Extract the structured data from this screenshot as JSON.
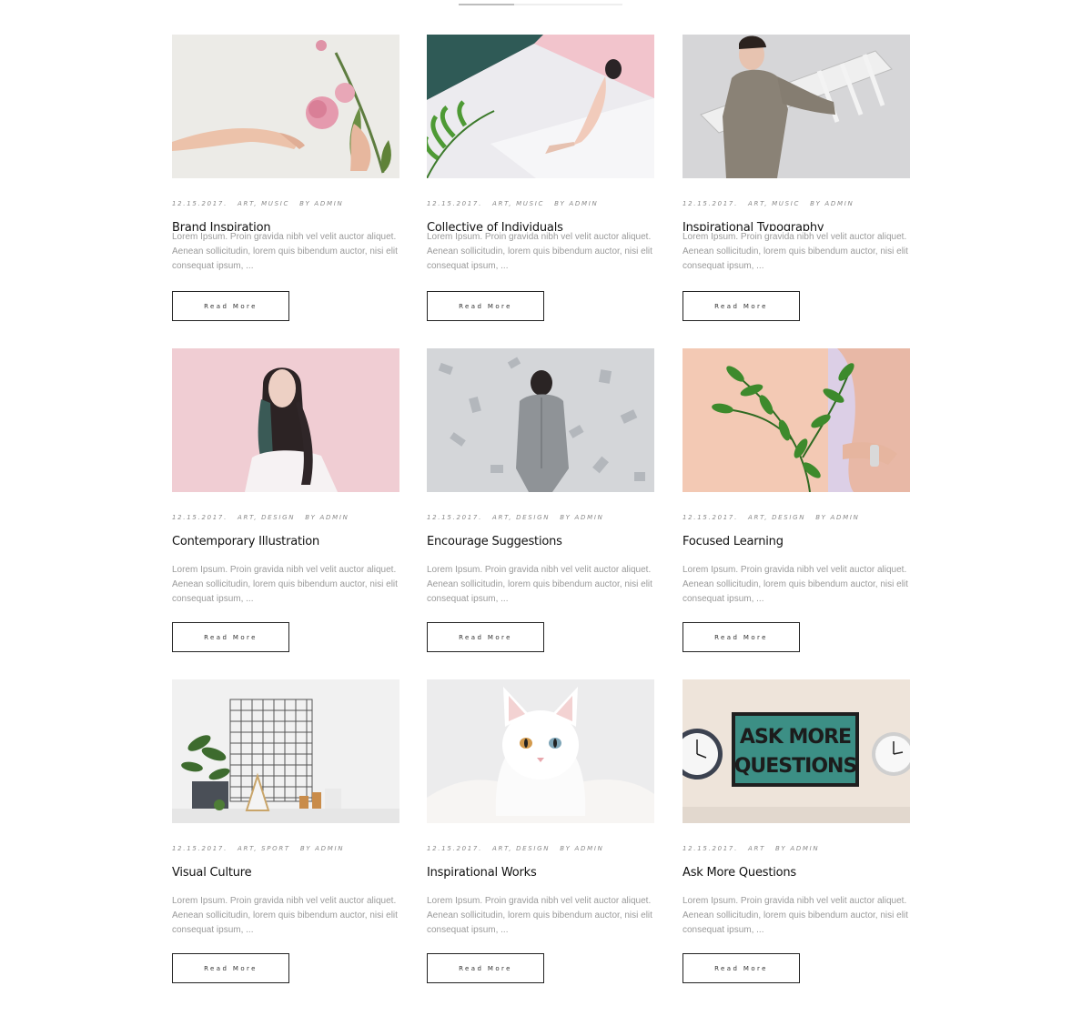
{
  "posts": [
    {
      "date": "12.15.2017.",
      "categories": "ART, MUSIC",
      "author": "BY ADMIN",
      "title": "Brand Inspiration",
      "excerpt": "Lorem Ipsum. Proin gravida nibh vel velit auctor aliquet. Aenean sollicitudin, lorem quis bibendum auctor, nisi elit consequat ipsum, ...",
      "button": "Read More",
      "image": "hand-pink-rose"
    },
    {
      "date": "12.15.2017.",
      "categories": "ART, MUSIC",
      "author": "BY ADMIN",
      "title": "Collective of Individuals",
      "excerpt": "Lorem Ipsum. Proin gravida nibh vel velit auctor aliquet. Aenean sollicitudin, lorem quis bibendum auctor, nisi elit consequat ipsum, ...",
      "button": "Read More",
      "image": "woman-pink-teal-palm"
    },
    {
      "date": "12.15.2017.",
      "categories": "ART, MUSIC",
      "author": "BY ADMIN",
      "title": "Inspirational Typography",
      "excerpt": "Lorem Ipsum. Proin gravida nibh vel velit auctor aliquet. Aenean sollicitudin, lorem quis bibendum auctor, nisi elit consequat ipsum, ...",
      "button": "Read More",
      "image": "man-carrying-ladder"
    },
    {
      "date": "12.15.2017.",
      "categories": "ART, DESIGN",
      "author": "BY ADMIN",
      "title": "Contemporary Illustration",
      "excerpt": "Lorem Ipsum. Proin gravida nibh vel velit auctor aliquet. Aenean sollicitudin, lorem quis bibendum auctor, nisi elit consequat ipsum, ...",
      "button": "Read More",
      "image": "woman-pink-background"
    },
    {
      "date": "12.15.2017.",
      "categories": "ART, DESIGN",
      "author": "BY ADMIN",
      "title": "Encourage Suggestions",
      "excerpt": "Lorem Ipsum. Proin gravida nibh vel velit auctor aliquet. Aenean sollicitudin, lorem quis bibendum auctor, nisi elit consequat ipsum, ...",
      "button": "Read More",
      "image": "man-grey-wall"
    },
    {
      "date": "12.15.2017.",
      "categories": "ART, DESIGN",
      "author": "BY ADMIN",
      "title": "Focused Learning",
      "excerpt": "Lorem Ipsum. Proin gravida nibh vel velit auctor aliquet. Aenean sollicitudin, lorem quis bibendum auctor, nisi elit consequat ipsum, ...",
      "button": "Read More",
      "image": "hand-green-plant"
    },
    {
      "date": "12.15.2017.",
      "categories": "ART, SPORT",
      "author": "BY ADMIN",
      "title": "Visual Culture",
      "excerpt": "Lorem Ipsum. Proin gravida nibh vel velit auctor aliquet. Aenean sollicitudin, lorem quis bibendum auctor, nisi elit consequat ipsum, ...",
      "button": "Read More",
      "image": "shelf-grid-plants"
    },
    {
      "date": "12.15.2017.",
      "categories": "ART, DESIGN",
      "author": "BY ADMIN",
      "title": "Inspirational Works",
      "excerpt": "Lorem Ipsum. Proin gravida nibh vel velit auctor aliquet. Aenean sollicitudin, lorem quis bibendum auctor, nisi elit consequat ipsum, ...",
      "button": "Read More",
      "image": "white-cat"
    },
    {
      "date": "12.15.2017.",
      "categories": "ART",
      "author": "BY ADMIN",
      "title": "Ask More Questions",
      "excerpt": "Lorem Ipsum. Proin gravida nibh vel velit auctor aliquet. Aenean sollicitudin, lorem quis bibendum auctor, nisi elit consequat ipsum, ...",
      "button": "Read More",
      "image": "ask-more-questions-poster",
      "poster_text": [
        "ASK MORE",
        "QUESTIONS"
      ]
    }
  ]
}
